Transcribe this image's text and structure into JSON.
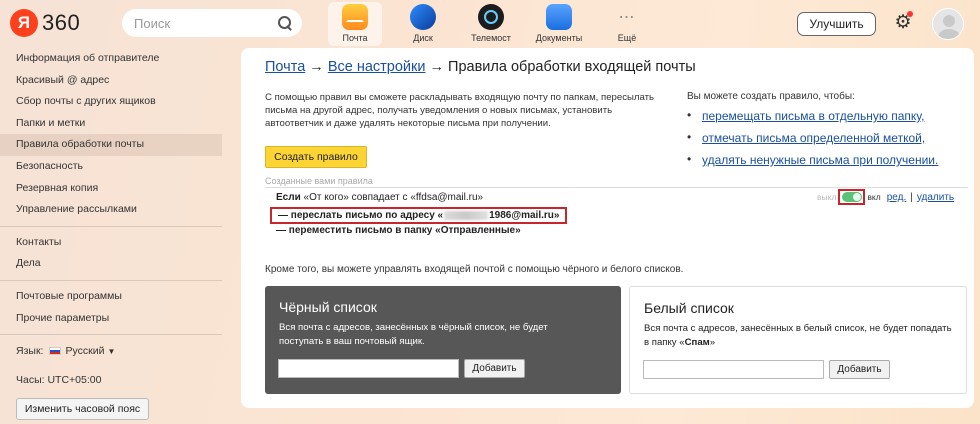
{
  "header": {
    "logo_letter": "Я",
    "logo_text": "360",
    "search_placeholder": "Поиск",
    "apps": [
      {
        "label": "Почта",
        "icon": "mail-icon",
        "active": true
      },
      {
        "label": "Диск",
        "icon": "disk-icon",
        "active": false
      },
      {
        "label": "Телемост",
        "icon": "telemost-icon",
        "active": false
      },
      {
        "label": "Документы",
        "icon": "documents-icon",
        "active": false
      },
      {
        "label": "Ещё",
        "icon": "more-icon",
        "active": false
      }
    ],
    "upgrade_label": "Улучшить",
    "settings_icon": "gear-icon",
    "notification_color": "#ff3333",
    "avatar_icon": "avatar-icon"
  },
  "sidebar": {
    "group1": [
      {
        "label": "Информация об отправителе"
      },
      {
        "label": "Красивый @ адрес"
      },
      {
        "label": "Сбор почты с других ящиков"
      },
      {
        "label": "Папки и метки"
      },
      {
        "label": "Правила обработки почты",
        "active": true
      },
      {
        "label": "Безопасность"
      },
      {
        "label": "Резервная копия"
      },
      {
        "label": "Управление рассылками"
      }
    ],
    "group2": [
      {
        "label": "Контакты"
      },
      {
        "label": "Дела"
      }
    ],
    "group3": [
      {
        "label": "Почтовые программы"
      },
      {
        "label": "Прочие параметры"
      }
    ],
    "language_label": "Язык:",
    "language_value": "Русский",
    "time_label": "Часы: UTC+05:00",
    "timezone_button": "Изменить часовой пояс"
  },
  "main": {
    "breadcrumb": {
      "mail": "Почта",
      "arrow1": "→",
      "all_settings": "Все настройки",
      "arrow2": "→",
      "current": "Правила обработки входящей почты"
    },
    "intro": "С помощью правил вы сможете раскладывать входящую почту по папкам, пересылать письма на другой адрес, получать уведомления о новых письмах, установить автоответчик и даже удалять некоторые письма при получении.",
    "create_button": "Создать правило",
    "right_heading": "Вы можете создать правило, чтобы:",
    "right_links": [
      "перемещать письма в отдельную папку,",
      "отмечать письма определенной меткой,",
      "удалять ненужные письма при получении."
    ],
    "rules_caption": "Созданные вами правила",
    "rule": {
      "if_word": "Если",
      "condition": "«От кого» совпадает с «ffdsa@mail.ru»",
      "forward_prefix": "— переслать письмо по адресу «",
      "forward_suffix": "1986@mail.ru»",
      "move": "— переместить письмо в папку «Отправленные»",
      "off_label": "выкл",
      "on_label": "вкл",
      "enabled": true,
      "edit": "ред.",
      "separator": "|",
      "delete": "удалить"
    },
    "also_text": "Кроме того, вы можете управлять входящей почтой с помощью чёрного и белого списков.",
    "blacklist": {
      "title": "Чёрный список",
      "desc": "Вся почта с адресов, занесённых в чёрный список, не будет поступать в ваш почтовый ящик.",
      "input_value": "",
      "add_button": "Добавить"
    },
    "whitelist": {
      "title": "Белый список",
      "desc_prefix": "Вся почта с адресов, занесённых в белый список, не будет попадать в папку «",
      "desc_bold": "Спам",
      "desc_suffix": "»",
      "input_value": "",
      "add_button": "Добавить"
    }
  }
}
